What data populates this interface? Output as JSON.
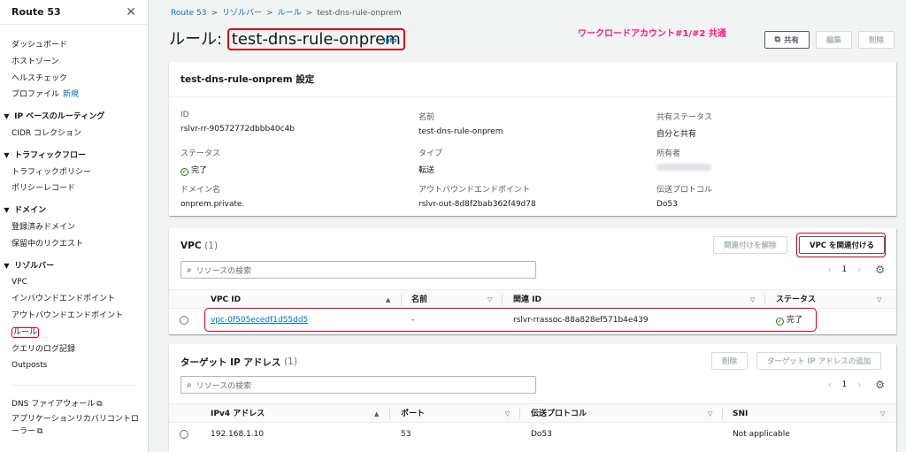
{
  "sidebar": {
    "title": "Route 53",
    "close_glyph": "✕",
    "top_items": [
      "ダッシュボード",
      "ホストゾーン",
      "ヘルスチェック"
    ],
    "profile_label": "プロファイル",
    "profile_badge": "新規",
    "sections": [
      {
        "title": "IP ベースのルーティング",
        "items": [
          "CIDR コレクション"
        ]
      },
      {
        "title": "トラフィックフロー",
        "items": [
          "トラフィックポリシー",
          "ポリシーレコード"
        ]
      },
      {
        "title": "ドメイン",
        "items": [
          "登録済みドメイン",
          "保留中のリクエスト"
        ]
      },
      {
        "title": "リゾルバー",
        "items": [
          "VPC",
          "インバウンドエンドポイント",
          "アウトバウンドエンドポイント",
          "ルール",
          "クエリのログ記録",
          "Outposts"
        ]
      }
    ],
    "bottom_items": [
      "DNS ファイアウォール",
      "アプリケーションリカバリコントロ",
      "ーラー"
    ],
    "caret_glyph": "▼",
    "external_glyph": "⧉"
  },
  "breadcrumb": {
    "items": [
      "Route 53",
      "リゾルバー",
      "ルール",
      "test-dns-rule-onprem"
    ],
    "separator": ">"
  },
  "header": {
    "title_prefix": "ルール: ",
    "title_name": "test-dns-rule-onprem",
    "info": "Info",
    "annotation": "ワークロードアカウント#1/#2 共通",
    "buttons": {
      "share": "共有",
      "share_icon": "⧉",
      "edit": "編集",
      "delete": "削除"
    }
  },
  "settings": {
    "heading": "test-dns-rule-onprem 設定",
    "fields": {
      "id_label": "ID",
      "id_value": "rslvr-rr-90572772dbbb40c4b",
      "name_label": "名前",
      "name_value": "test-dns-rule-onprem",
      "share_status_label": "共有ステータス",
      "share_status_value": "自分と共有",
      "status_label": "ステータス",
      "status_value": "完了",
      "type_label": "タイプ",
      "type_value": "転送",
      "owner_label": "所有者",
      "domain_label": "ドメイン名",
      "domain_value": "onprem.private.",
      "outbound_label": "アウトバウンドエンドポイント",
      "outbound_value": "rslvr-out-8d8f2bab362f49d78",
      "protocol_label": "伝送プロトコル",
      "protocol_value": "Do53"
    }
  },
  "vpc_panel": {
    "heading": "VPC",
    "count": "(1)",
    "btn_disassociate": "関連付けを解除",
    "btn_associate": "VPC を関連付ける",
    "search_placeholder": "リソースの検索",
    "page": "1",
    "columns": [
      "VPC ID",
      "名前",
      "関連 ID",
      "ステータス"
    ],
    "rows": [
      {
        "vpc_id": "vpc-0f505ecedf1d55dd5",
        "name": "-",
        "assoc_id": "rslvr-rrassoc-88a828ef571b4e439",
        "status": "完了"
      }
    ]
  },
  "target_panel": {
    "heading": "ターゲット IP アドレス",
    "count": "(1)",
    "btn_delete": "削除",
    "btn_add": "ターゲット IP アドレスの追加",
    "search_placeholder": "リソースの検索",
    "page": "1",
    "columns": [
      "IPv4 アドレス",
      "ポート",
      "伝送プロトコル",
      "SNI"
    ],
    "rows": [
      {
        "ip": "192.168.1.10",
        "port": "53",
        "protocol": "Do53",
        "sni": "Not applicable"
      }
    ]
  },
  "icons": {
    "search": "⌕",
    "prev": "‹",
    "next": "›",
    "settings": "⚙",
    "sort_up": "▲",
    "sort_down": "▽",
    "check": "✓"
  },
  "colors": {
    "accent": "#0073bb",
    "success": "#1d8102",
    "highlight": "#d0021b",
    "annotation": "#ff1a7a"
  }
}
